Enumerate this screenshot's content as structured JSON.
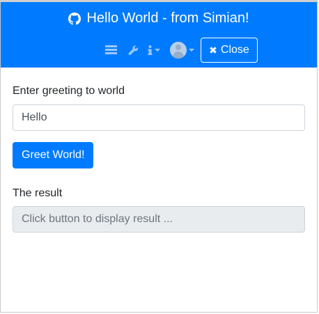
{
  "colors": {
    "header_bg": "#007bff",
    "primary": "#007bff",
    "text": "#212529",
    "readonly_bg": "#e9ecef",
    "placeholder": "#6c757d"
  },
  "header": {
    "title": "Hello World - from Simian!",
    "title_icon": "github-icon",
    "toolbar": {
      "icons": [
        "list-icon",
        "wrench-icon",
        "info-icon",
        "user-avatar-icon"
      ],
      "close_icon": "close-icon",
      "close_label": "Close"
    }
  },
  "form": {
    "greeting_label": "Enter greeting to world",
    "greeting_value": "Hello",
    "greet_button_label": "Greet World!",
    "result_label": "The result",
    "result_placeholder": "Click button to display result ..."
  }
}
